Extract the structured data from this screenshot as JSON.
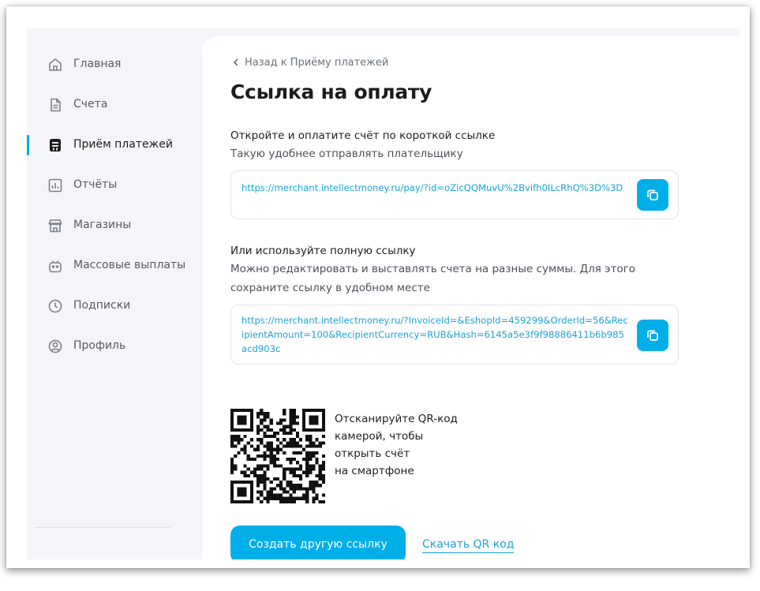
{
  "sidebar": {
    "items": [
      {
        "label": "Главная",
        "icon": "home-icon",
        "active": false
      },
      {
        "label": "Счета",
        "icon": "document-icon",
        "active": false
      },
      {
        "label": "Приём платежей",
        "icon": "payments-icon",
        "active": true
      },
      {
        "label": "Отчёты",
        "icon": "chart-icon",
        "active": false
      },
      {
        "label": "Магазины",
        "icon": "store-icon",
        "active": false
      },
      {
        "label": "Массовые выплаты",
        "icon": "mass-payout-icon",
        "active": false
      },
      {
        "label": "Подписки",
        "icon": "clock-icon",
        "active": false
      },
      {
        "label": "Профиль",
        "icon": "profile-icon",
        "active": false
      }
    ]
  },
  "back_link": "Назад к Приёму платежей",
  "page_title": "Ссылка на оплату",
  "short_link": {
    "title": "Откройте и оплатите счёт по короткой ссылке",
    "description": "Такую удобнее отправлять плательщику",
    "url": "https://merchant.intellectmoney.ru/pay/?id=oZicQQMuvU%2Bvifh0ILcRhQ%3D%3D"
  },
  "full_link": {
    "title": "Или используйте полную ссылку",
    "description": "Можно редактировать и выставлять счета на разные суммы. Для этого сохраните ссылку в удобном месте",
    "url": "https://merchant.intellectmoney.ru/?InvoiceId=&EshopId=459299&OrderId=56&RecipientAmount=100&RecipientCurrency=RUB&Hash=6145a5e3f9f98886411b6b985acd903c"
  },
  "qr": {
    "caption_lines": [
      "Отсканируйте QR-код",
      "камерой, чтобы",
      "открыть счёт",
      "на смартфоне"
    ]
  },
  "actions": {
    "create_label": "Создать другую ссылку",
    "download_label": "Скачать QR код"
  },
  "colors": {
    "accent": "#00aee8",
    "link": "#1aa3d6",
    "sidebar_bg": "#f4f5f8"
  }
}
